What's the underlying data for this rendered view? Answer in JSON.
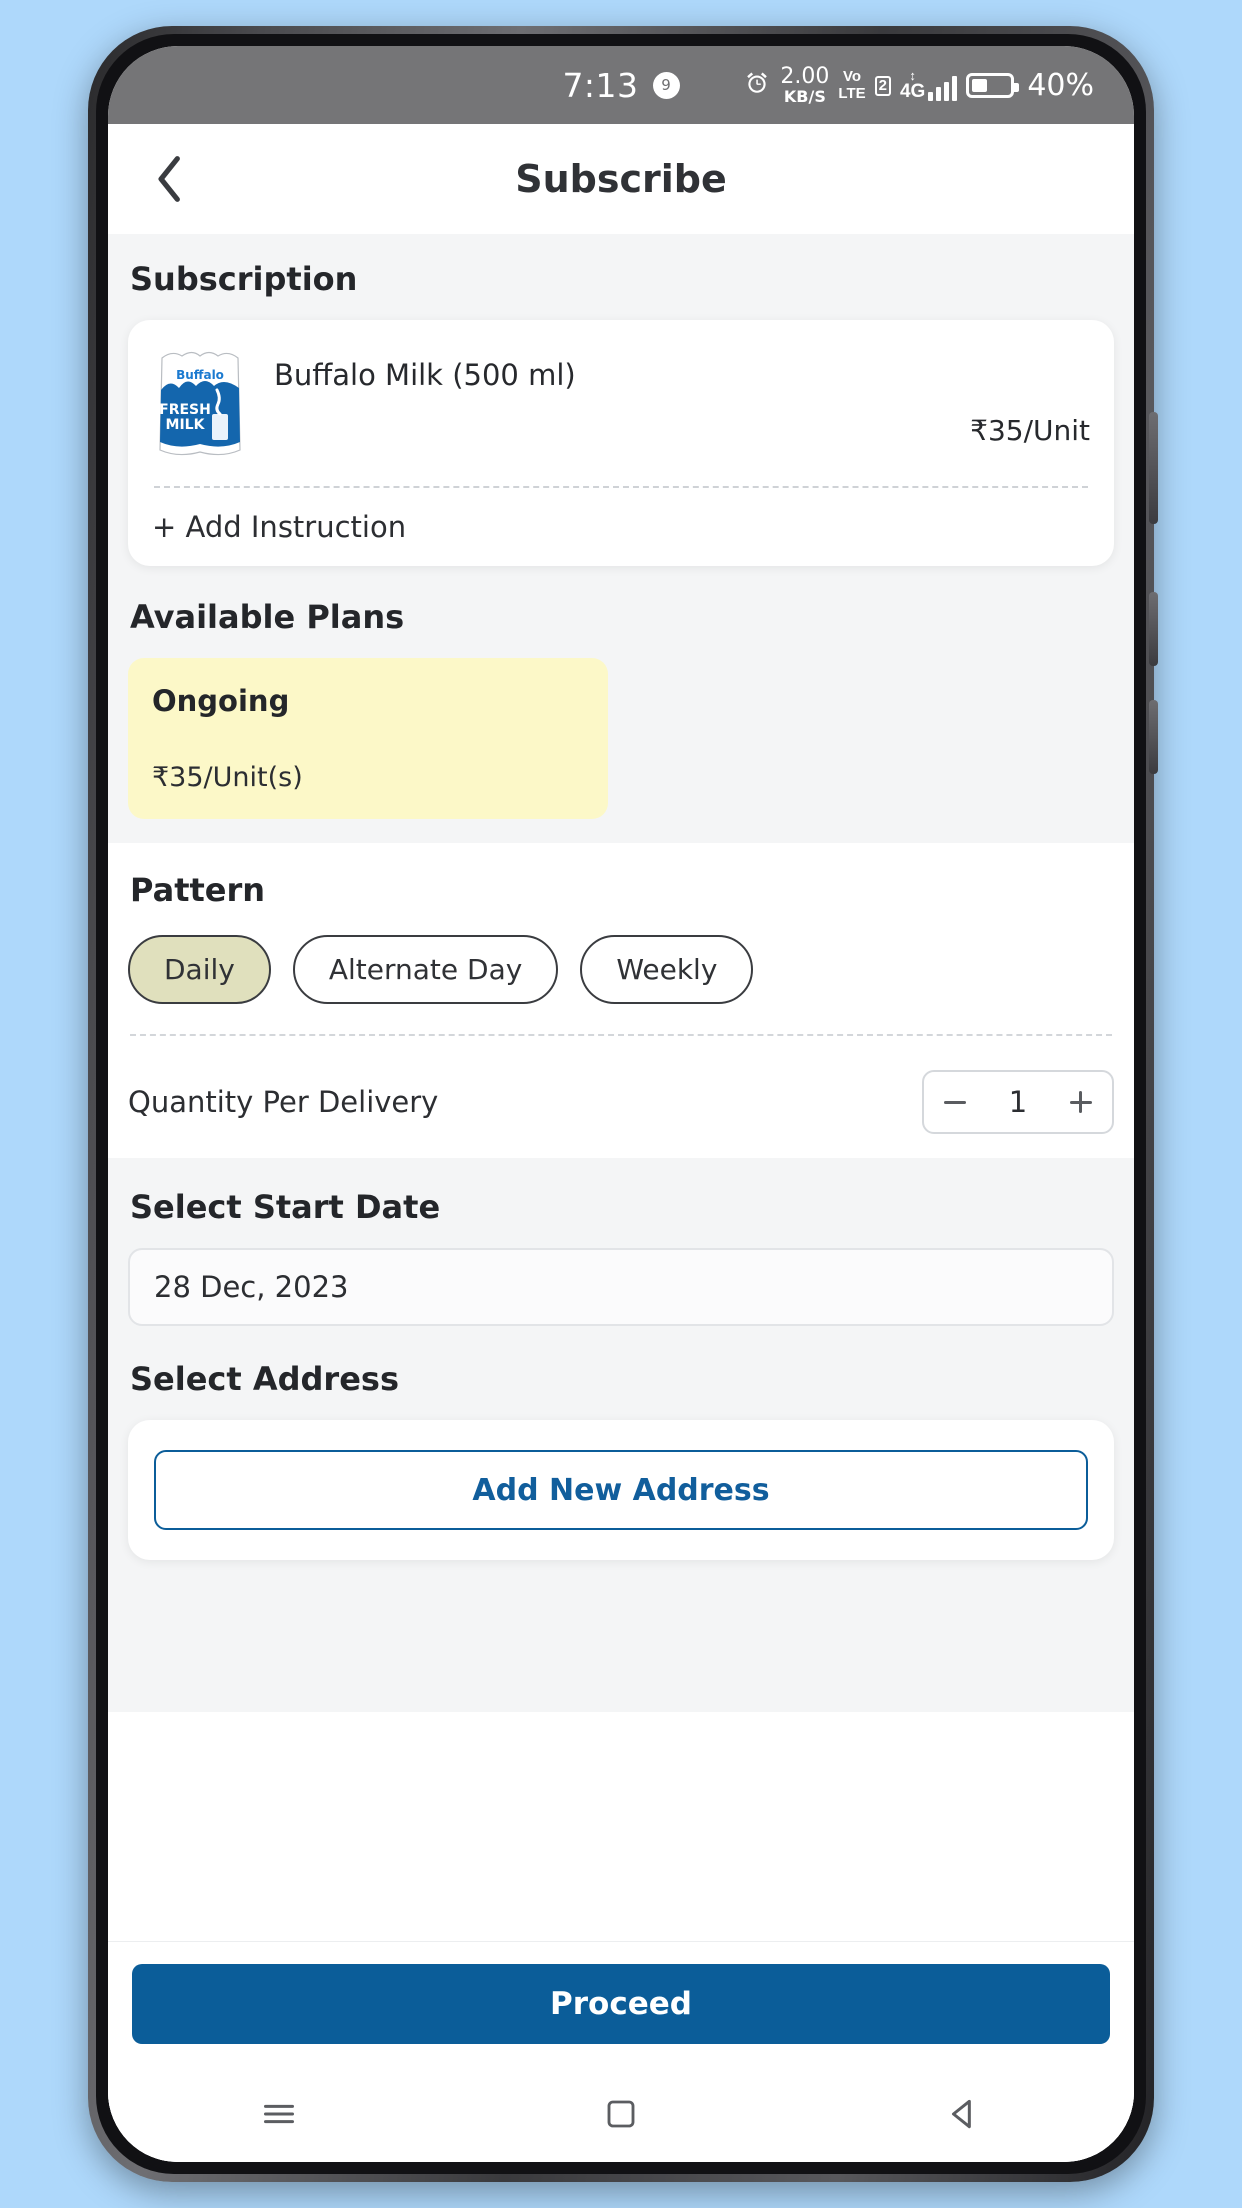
{
  "statusbar": {
    "time": "7:13",
    "badge": "9",
    "alarm_icon": "alarm-clock-icon",
    "netspeed_value": "2.00",
    "netspeed_unit": "KB/S",
    "volte_top": "Vo",
    "volte_bottom": "LTE",
    "sim_badge": "2",
    "network_type": "4G",
    "signal_icon": "signal-bars-icon",
    "battery_icon": "battery-icon",
    "battery_percent": "40%"
  },
  "appbar": {
    "back_icon": "back-chevron-icon",
    "title": "Subscribe"
  },
  "subscription": {
    "heading": "Subscription",
    "product": {
      "image_alt": "buffalo-fresh-milk-packet",
      "pack_brand": "Buffalo",
      "pack_line1": "FRESH",
      "pack_line2": "MILK",
      "name": "Buffalo Milk (500 ml)",
      "price": "₹35/Unit"
    },
    "add_instruction": "+ Add Instruction"
  },
  "available_plans": {
    "heading": "Available Plans",
    "plans": [
      {
        "name": "Ongoing",
        "price": "₹35/Unit(s)",
        "selected": true,
        "bg": "#fcf8c8"
      }
    ]
  },
  "pattern": {
    "heading": "Pattern",
    "options": [
      {
        "label": "Daily",
        "selected": true
      },
      {
        "label": "Alternate Day",
        "selected": false
      },
      {
        "label": "Weekly",
        "selected": false
      }
    ]
  },
  "quantity": {
    "label": "Quantity Per Delivery",
    "decrement_icon": "minus-icon",
    "value": "1",
    "increment_icon": "plus-icon"
  },
  "start_date": {
    "heading": "Select Start Date",
    "value": "28 Dec, 2023"
  },
  "address": {
    "heading": "Select Address",
    "add_button": "Add New Address"
  },
  "footer": {
    "proceed": "Proceed"
  },
  "navbar": {
    "menu_icon": "menu-icon",
    "home_icon": "home-square-icon",
    "back_icon": "back-triangle-icon"
  },
  "colors": {
    "page_bg": "#aed8fb",
    "accent_blue": "#0b5d99",
    "plan_yellow": "#fcf8c8",
    "chip_selected": "#e0e0bd",
    "section_grey": "#f4f5f6",
    "statusbar_grey": "#757577"
  }
}
